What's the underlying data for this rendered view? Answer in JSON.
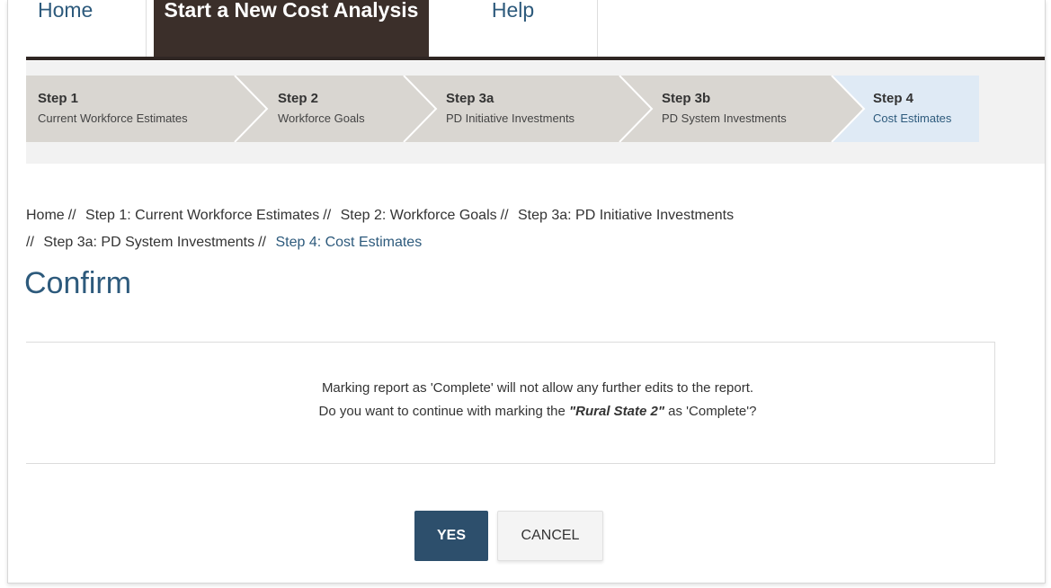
{
  "nav": {
    "tabs": [
      {
        "label": "Home"
      },
      {
        "label": "Start a New Cost Analysis"
      },
      {
        "label": "Help"
      }
    ]
  },
  "steps": [
    {
      "number": "Step 1",
      "label": "Current Workforce Estimates",
      "state": "inactive"
    },
    {
      "number": "Step 2",
      "label": "Workforce Goals",
      "state": "inactive"
    },
    {
      "number": "Step 3a",
      "label": "PD Initiative Investments",
      "state": "inactive"
    },
    {
      "number": "Step 3b",
      "label": "PD System Investments",
      "state": "inactive"
    },
    {
      "number": "Step 4",
      "label": "Cost Estimates",
      "state": "active"
    }
  ],
  "breadcrumb": {
    "separator": "//",
    "items": [
      "Home",
      "Step 1: Current Workforce Estimates",
      "Step 2: Workforce Goals",
      "Step 3a: PD Initiative Investments",
      "Step 3a: PD System Investments",
      "Step 4: Cost Estimates"
    ]
  },
  "page": {
    "title": "Confirm"
  },
  "confirm": {
    "line1": "Marking report as 'Complete' will not allow any further edits to the report.",
    "line2_prefix": "Do you want to continue with marking the",
    "report_name": "\"Rural State 2\"",
    "line2_suffix": "as 'Complete'?"
  },
  "buttons": {
    "yes": "YES",
    "cancel": "CANCEL"
  },
  "colors": {
    "accent": "#2d5a7c",
    "active_tab": "#3b2f2a",
    "step_inactive": "#d9d6d1",
    "step_active": "#dfeaf5",
    "yes_button": "#2d4f6c"
  }
}
